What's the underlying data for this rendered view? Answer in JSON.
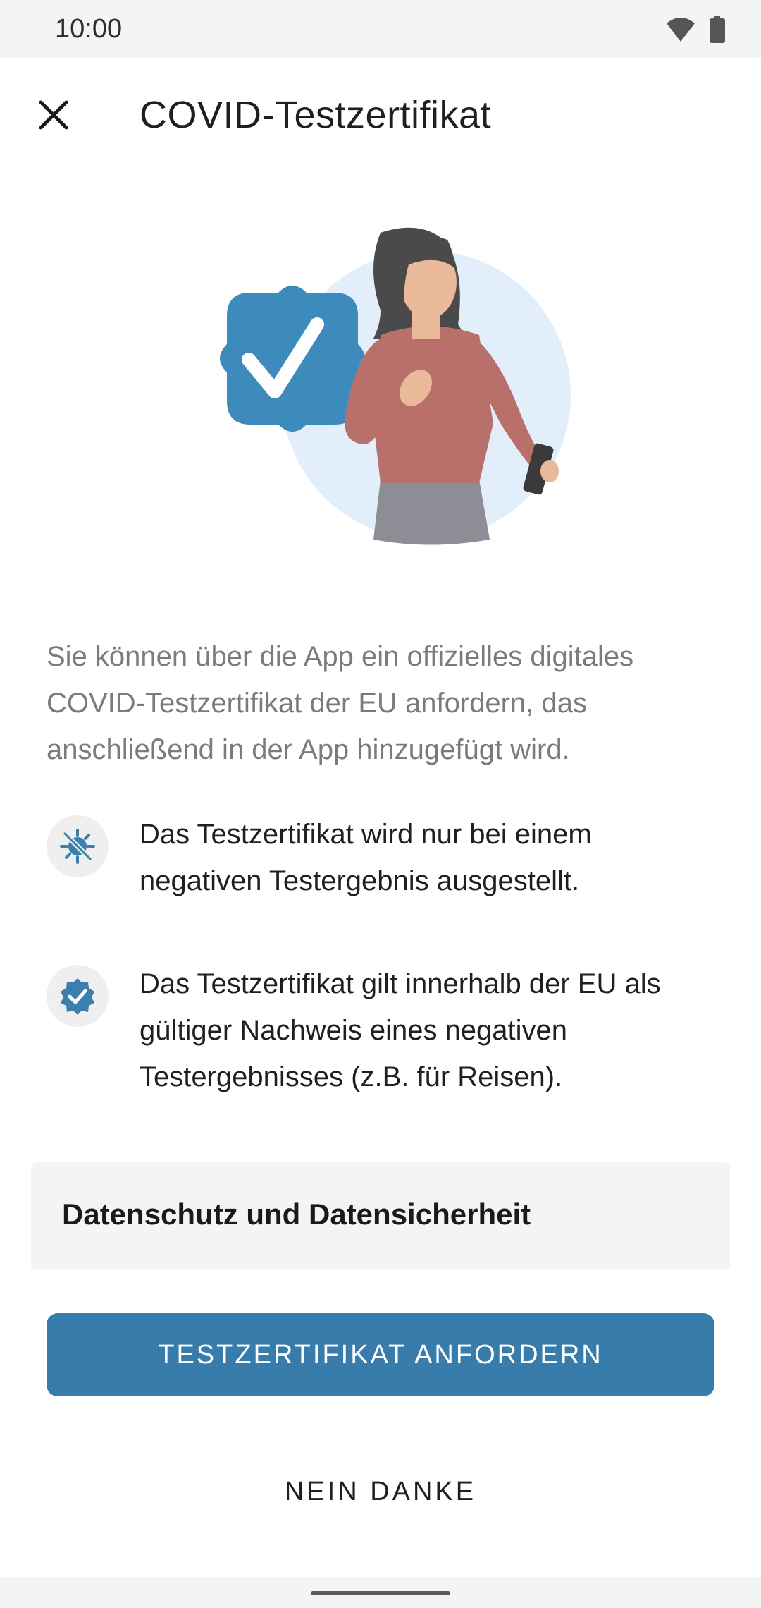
{
  "status": {
    "time": "10:00",
    "icons": [
      "wifi-icon",
      "battery-icon"
    ]
  },
  "appbar": {
    "title": "COVID-Testzertifikat",
    "close_icon": "close-icon"
  },
  "illustration": {
    "badge_color": "#3d8bbd",
    "circle_color": "#e3eefb"
  },
  "intro_text": "Sie können über die App ein offizielles digitales COVID-Testzertifikat der EU anfordern, das anschließend in der App hinzugefügt wird.",
  "features": [
    {
      "icon": "virus-crossed-icon",
      "text": "Das Testzertifikat wird nur bei einem negativen Testergebnis ausgestellt."
    },
    {
      "icon": "verified-badge-icon",
      "text": "Das Testzertifikat gilt innerhalb der EU als gültiger Nachweis eines negativen Testergebnisses (z.B. für Reisen)."
    }
  ],
  "privacy": {
    "title": "Datenschutz und Datensicherheit"
  },
  "buttons": {
    "primary_label": "TESTZERTIFIKAT ANFORDERN",
    "secondary_label": "NEIN DANKE"
  },
  "colors": {
    "accent": "#377cab",
    "text_secondary": "#7b7b7b"
  }
}
